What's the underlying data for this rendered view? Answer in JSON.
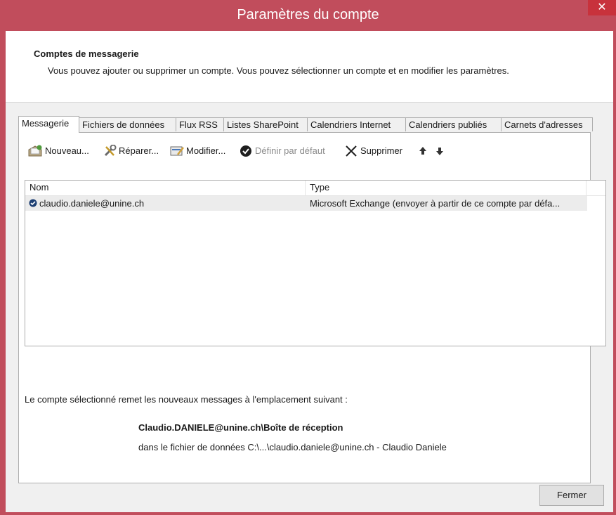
{
  "window": {
    "title": "Paramètres du compte",
    "close_glyph": "✕",
    "accent_color": "#c14d5c"
  },
  "header": {
    "title": "Comptes de messagerie",
    "description": "Vous pouvez ajouter ou supprimer un compte. Vous pouvez sélectionner un compte et en modifier les paramètres."
  },
  "tabs": [
    {
      "label": "Messagerie",
      "active": true
    },
    {
      "label": "Fichiers de données"
    },
    {
      "label": "Flux RSS"
    },
    {
      "label": "Listes SharePoint"
    },
    {
      "label": "Calendriers Internet"
    },
    {
      "label": "Calendriers publiés"
    },
    {
      "label": "Carnets d'adresses"
    }
  ],
  "toolbar": {
    "new_label": "Nouveau...",
    "repair_label": "Réparer...",
    "modify_label": "Modifier...",
    "default_label": "Définir par défaut",
    "delete_label": "Supprimer",
    "icons": [
      "new-account-icon",
      "repair-icon",
      "modify-icon",
      "checkmark-icon",
      "delete-x-icon",
      "arrow-up-icon",
      "arrow-down-icon"
    ]
  },
  "accounts_list": {
    "columns": [
      "Nom",
      "Type"
    ],
    "rows": [
      {
        "name": "claudio.daniele@unine.ch",
        "type": "Microsoft Exchange (envoyer à partir de ce compte par défa..."
      }
    ]
  },
  "delivery": {
    "label": "Le compte sélectionné remet les nouveaux messages à l'emplacement suivant :",
    "folder": "Claudio.DANIELE@unine.ch\\Boîte de réception",
    "file": "dans le fichier de données C:\\...\\claudio.daniele@unine.ch - Claudio Daniele"
  },
  "footer": {
    "close_label": "Fermer"
  }
}
